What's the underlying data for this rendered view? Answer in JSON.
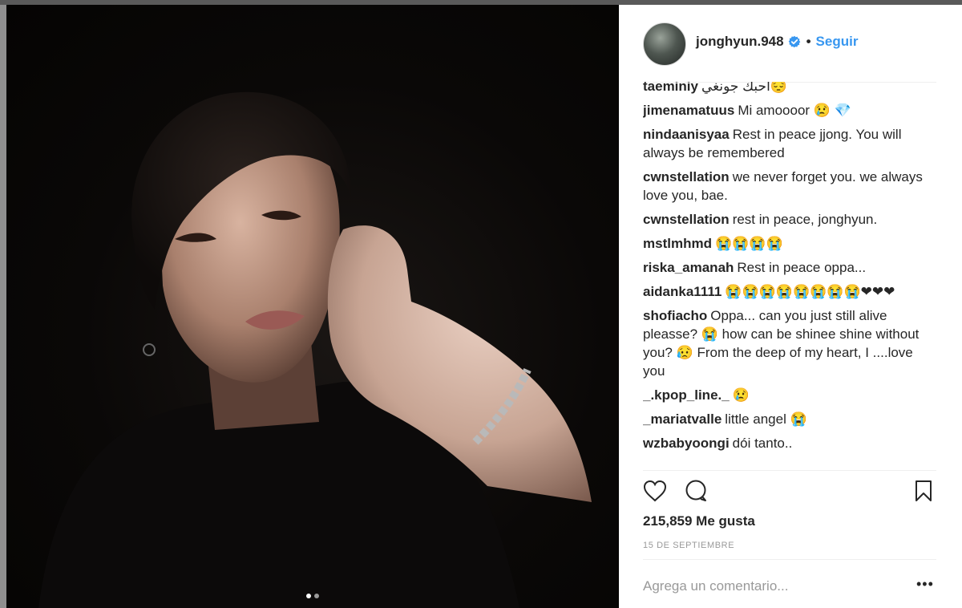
{
  "post": {
    "username": "jonghyun.948",
    "separator": "•",
    "follow_label": "Seguir",
    "likes": "215,859 Me gusta",
    "date": "15 DE SEPTIEMBRE",
    "comment_placeholder": "Agrega un comentario...",
    "more_label": "•••",
    "carousel": {
      "count": 2,
      "active": 0
    }
  },
  "comments": [
    {
      "user": "taeminiy",
      "text": "احبك جونغي😔"
    },
    {
      "user": "jimenamatuus",
      "text": "Mi amoooor 😢 💎"
    },
    {
      "user": "nindaanisyaa",
      "text": "Rest in peace jjong. You will always be remembered"
    },
    {
      "user": "cwnstellation",
      "text": "we never forget you. we always love you, bae."
    },
    {
      "user": "cwnstellation",
      "text": "rest in peace, jonghyun."
    },
    {
      "user": "mstlmhmd",
      "text": "😭😭😭😭"
    },
    {
      "user": "riska_amanah",
      "text": "Rest in peace oppa..."
    },
    {
      "user": "aidanka1111",
      "text": "😭😭😭😭😭😭😭😭❤❤❤"
    },
    {
      "user": "shofiacho",
      "text": "Oppa... can you just still alive pleasse? 😭 how can be shinee shine without you? 😥 From the deep of my heart, I ....love you"
    },
    {
      "user": "_.kpop_line._",
      "text": "😢"
    },
    {
      "user": "_mariatvalle",
      "text": "little angel 😭"
    },
    {
      "user": "wzbabyoongi",
      "text": "dói tanto.."
    }
  ],
  "icons": {
    "like": "heart-icon",
    "comment": "comment-bubble-icon",
    "save": "bookmark-icon",
    "verified": "verified-badge-icon"
  },
  "colors": {
    "link_blue": "#3897f0",
    "text": "#262626",
    "muted": "#999999",
    "divider": "#efefef"
  }
}
